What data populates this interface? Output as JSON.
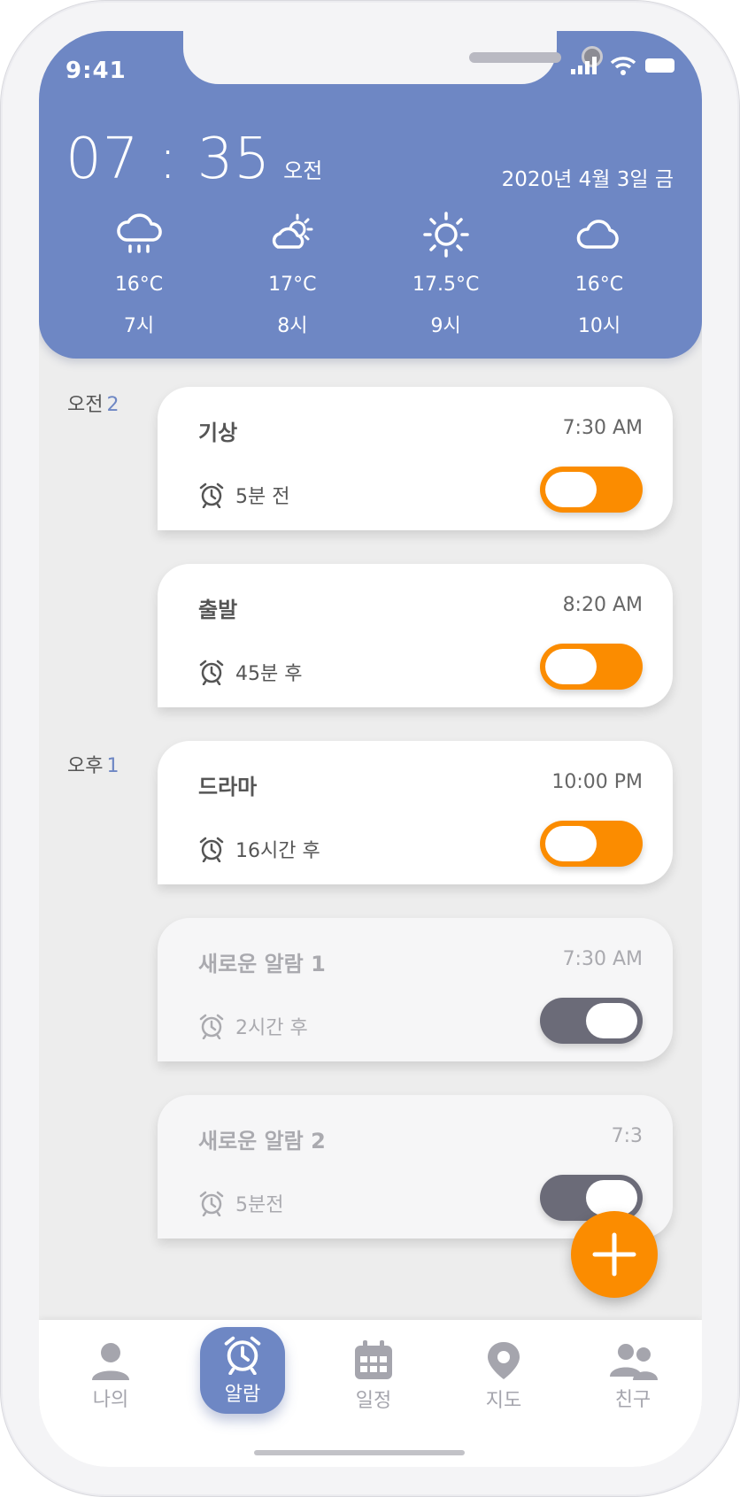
{
  "status_bar": {
    "time": "9:41"
  },
  "header": {
    "clock_time": "07 : 35",
    "clock_ampm": "오전",
    "date": "2020년 4월 3일 금",
    "forecast": [
      {
        "icon": "rain-cloud-icon",
        "temp": "16°C",
        "hour": "7시"
      },
      {
        "icon": "partly-sunny-icon",
        "temp": "17°C",
        "hour": "8시"
      },
      {
        "icon": "sun-icon",
        "temp": "17.5°C",
        "hour": "9시"
      },
      {
        "icon": "cloud-icon",
        "temp": "16°C",
        "hour": "10시"
      }
    ]
  },
  "sections": [
    {
      "label": "오전",
      "count": "2"
    },
    {
      "label": "오후",
      "count": "1"
    }
  ],
  "alarms": [
    {
      "name": "기상",
      "time": "7:30 AM",
      "relative": "5분 전",
      "enabled": true
    },
    {
      "name": "출발",
      "time": "8:20 AM",
      "relative": "45분 후",
      "enabled": true
    },
    {
      "name": "드라마",
      "time": "10:00 PM",
      "relative": "16시간 후",
      "enabled": true
    },
    {
      "name": "새로운 알람 1",
      "time": "7:30 AM",
      "relative": "2시간 후",
      "enabled": false
    },
    {
      "name": "새로운 알람 2",
      "time": "7:3",
      "relative": "5분전",
      "enabled": false
    }
  ],
  "tabbar": {
    "items": [
      {
        "label": "나의",
        "icon": "person-icon",
        "active": false
      },
      {
        "label": "알람",
        "icon": "alarm-clock-icon",
        "active": true
      },
      {
        "label": "일정",
        "icon": "calendar-icon",
        "active": false
      },
      {
        "label": "지도",
        "icon": "map-pin-icon",
        "active": false
      },
      {
        "label": "친구",
        "icon": "friends-icon",
        "active": false
      }
    ]
  },
  "colors": {
    "header": "#6e87c4",
    "accent": "#fb8c00",
    "toggle_off": "#6b6b78"
  }
}
